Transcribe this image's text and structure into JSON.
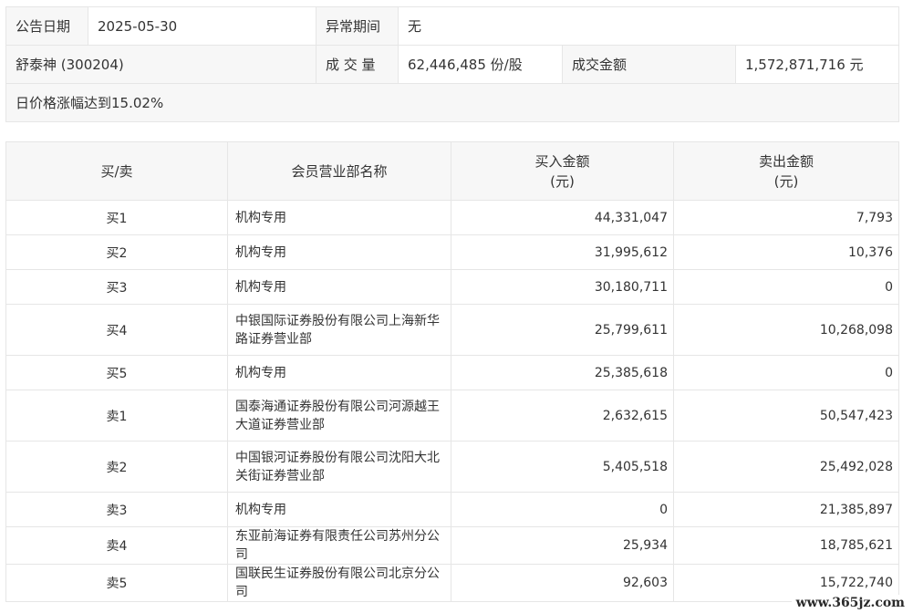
{
  "info": {
    "announce_date_label": "公告日期",
    "announce_date_value": "2025-05-30",
    "abnormal_period_label": "异常期间",
    "abnormal_period_value": "无",
    "stock": "舒泰神 (300204)",
    "volume_label": "成 交 量",
    "volume_value": "62,446,485 份/股",
    "amount_label": "成交金额",
    "amount_value": "1,572,871,716 元",
    "reason": "日价格涨幅达到15.02%"
  },
  "table": {
    "headers": {
      "side": "买/卖",
      "member": "会员营业部名称",
      "buy_line1": "买入金额",
      "buy_line2": "(元)",
      "sell_line1": "卖出金额",
      "sell_line2": "(元)"
    },
    "rows": [
      {
        "side": "买1",
        "name": "机构专用",
        "buy": "44,331,047",
        "sell": "7,793"
      },
      {
        "side": "买2",
        "name": "机构专用",
        "buy": "31,995,612",
        "sell": "10,376"
      },
      {
        "side": "买3",
        "name": "机构专用",
        "buy": "30,180,711",
        "sell": "0"
      },
      {
        "side": "买4",
        "name": "中银国际证券股份有限公司上海新华路证券营业部",
        "buy": "25,799,611",
        "sell": "10,268,098"
      },
      {
        "side": "买5",
        "name": "机构专用",
        "buy": "25,385,618",
        "sell": "0"
      },
      {
        "side": "卖1",
        "name": "国泰海通证券股份有限公司河源越王大道证券营业部",
        "buy": "2,632,615",
        "sell": "50,547,423"
      },
      {
        "side": "卖2",
        "name": "中国银河证券股份有限公司沈阳大北关街证券营业部",
        "buy": "5,405,518",
        "sell": "25,492,028"
      },
      {
        "side": "卖3",
        "name": "机构专用",
        "buy": "0",
        "sell": "21,385,897"
      },
      {
        "side": "卖4",
        "name": "东亚前海证券有限责任公司苏州分公司",
        "buy": "25,934",
        "sell": "18,785,621"
      },
      {
        "side": "卖5",
        "name": "国联民生证券股份有限公司北京分公司",
        "buy": "92,603",
        "sell": "15,722,740"
      }
    ]
  },
  "watermark": "www.365jz.com"
}
